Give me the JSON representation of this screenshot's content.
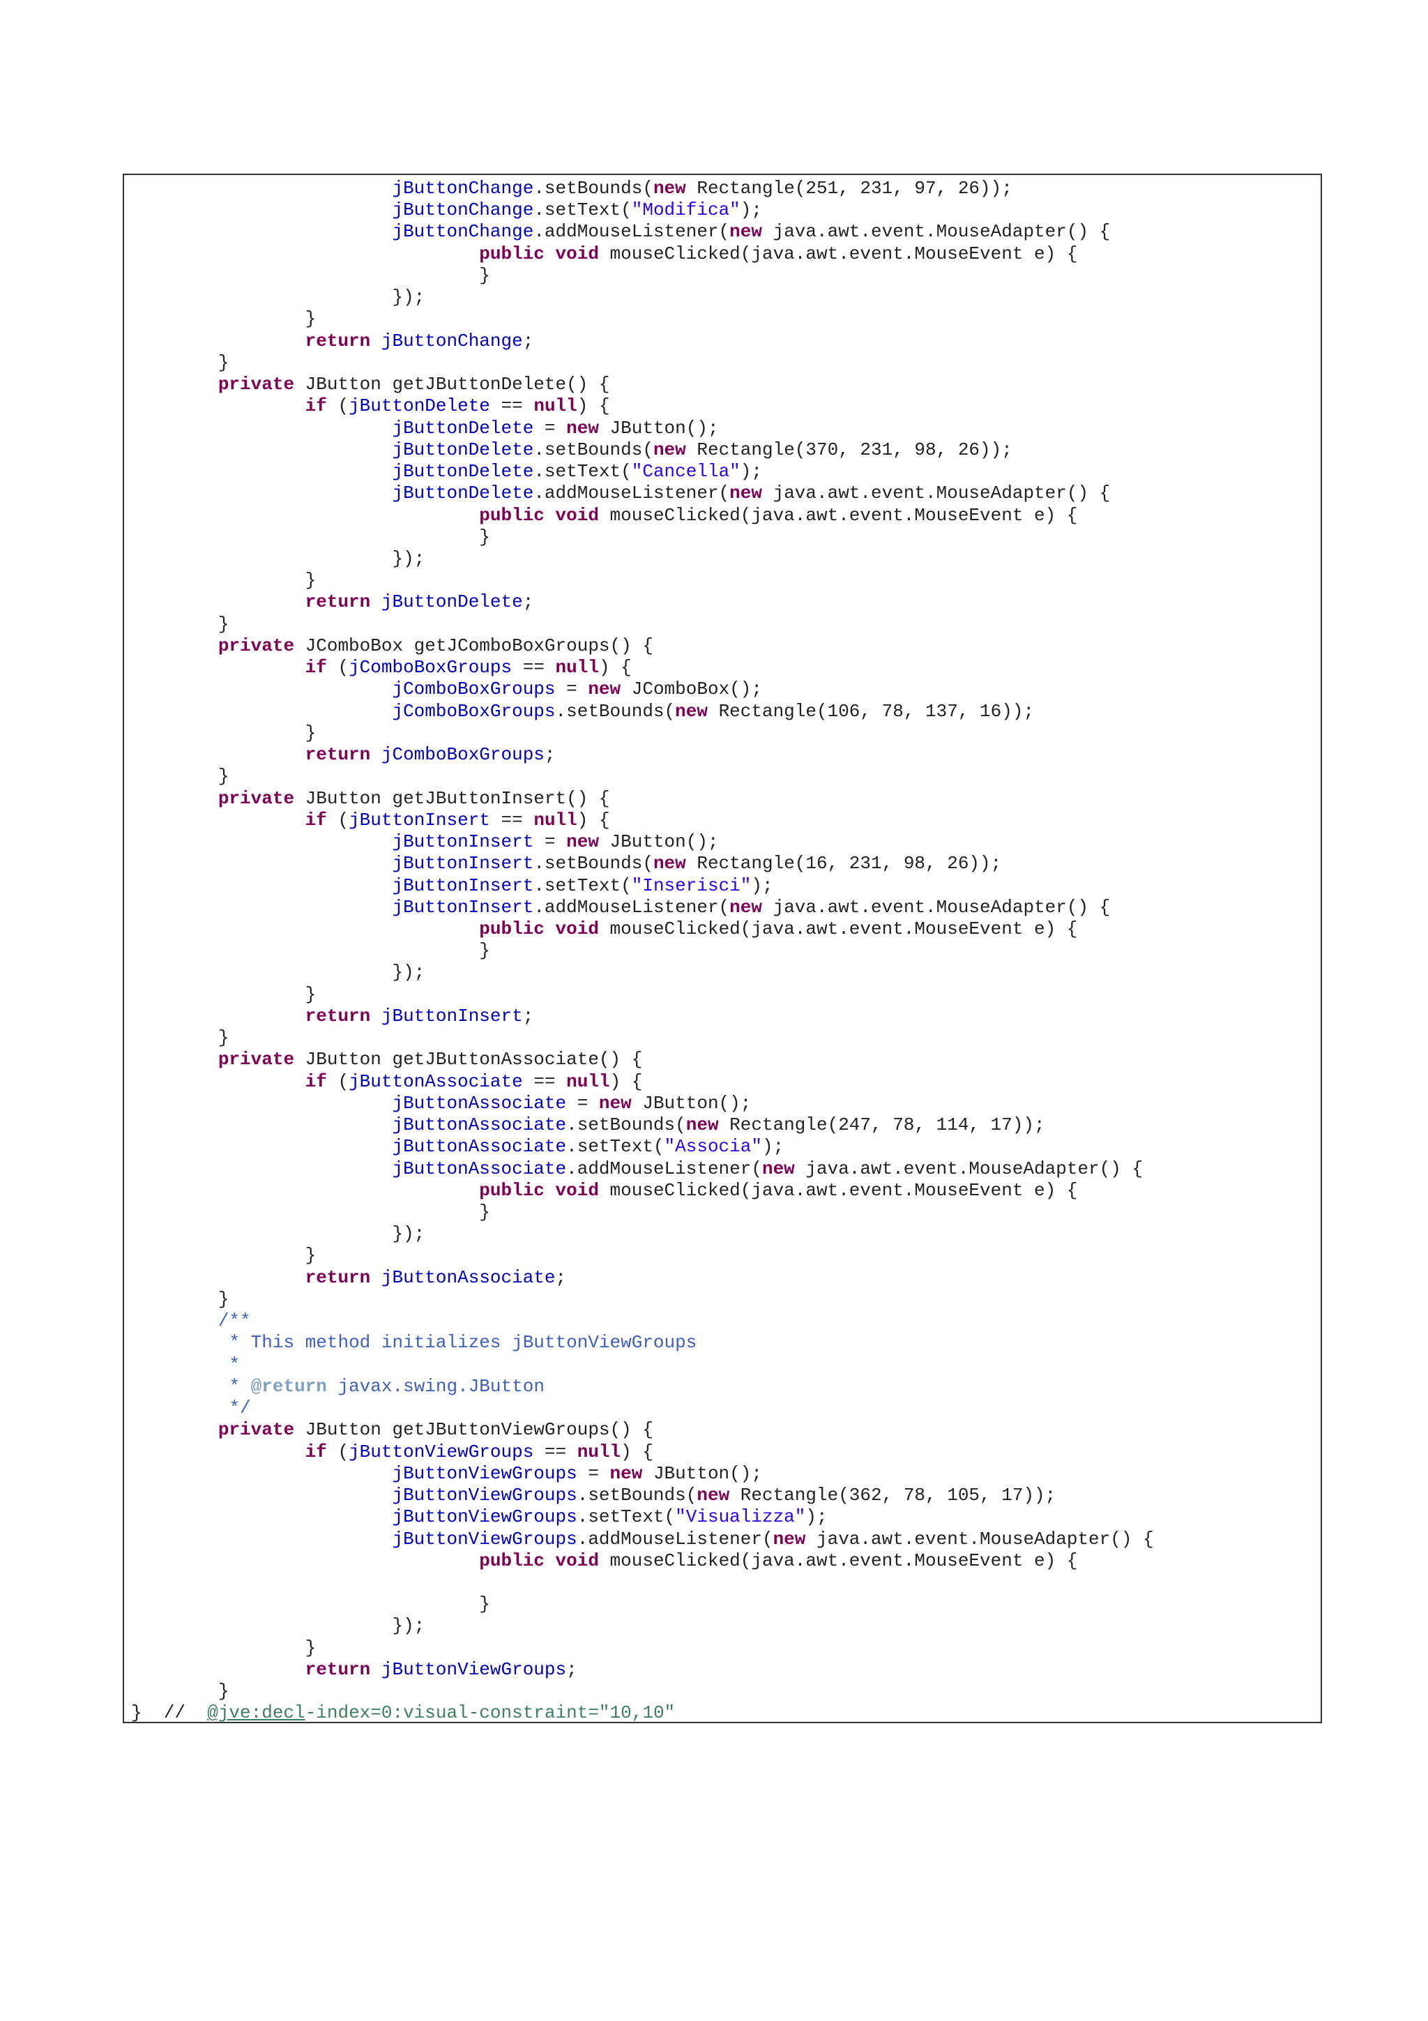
{
  "code_lines": [
    [
      {
        "c": "t",
        "s": "                        "
      },
      {
        "c": "fld",
        "s": "jButtonChange"
      },
      {
        "c": "t",
        "s": ".setBounds("
      },
      {
        "c": "kw",
        "s": "new"
      },
      {
        "c": "t",
        "s": " Rectangle(251, 231, 97, 26));"
      }
    ],
    [
      {
        "c": "t",
        "s": "                        "
      },
      {
        "c": "fld",
        "s": "jButtonChange"
      },
      {
        "c": "t",
        "s": ".setText("
      },
      {
        "c": "str",
        "s": "\"Modifica\""
      },
      {
        "c": "t",
        "s": ");"
      }
    ],
    [
      {
        "c": "t",
        "s": "                        "
      },
      {
        "c": "fld",
        "s": "jButtonChange"
      },
      {
        "c": "t",
        "s": ".addMouseListener("
      },
      {
        "c": "kw",
        "s": "new"
      },
      {
        "c": "t",
        "s": " java.awt.event.MouseAdapter() {"
      }
    ],
    [
      {
        "c": "t",
        "s": "                                "
      },
      {
        "c": "kw",
        "s": "public"
      },
      {
        "c": "t",
        "s": " "
      },
      {
        "c": "kw",
        "s": "void"
      },
      {
        "c": "t",
        "s": " mouseClicked(java.awt.event.MouseEvent e) {"
      }
    ],
    [
      {
        "c": "t",
        "s": "                                }"
      }
    ],
    [
      {
        "c": "t",
        "s": "                        });"
      }
    ],
    [
      {
        "c": "t",
        "s": "                }"
      }
    ],
    [
      {
        "c": "t",
        "s": "                "
      },
      {
        "c": "kw",
        "s": "return"
      },
      {
        "c": "t",
        "s": " "
      },
      {
        "c": "fld",
        "s": "jButtonChange"
      },
      {
        "c": "t",
        "s": ";"
      }
    ],
    [
      {
        "c": "t",
        "s": "        }"
      }
    ],
    [
      {
        "c": "t",
        "s": "        "
      },
      {
        "c": "kw",
        "s": "private"
      },
      {
        "c": "t",
        "s": " JButton getJButtonDelete() {"
      }
    ],
    [
      {
        "c": "t",
        "s": "                "
      },
      {
        "c": "kw",
        "s": "if"
      },
      {
        "c": "t",
        "s": " ("
      },
      {
        "c": "fld",
        "s": "jButtonDelete"
      },
      {
        "c": "t",
        "s": " == "
      },
      {
        "c": "kw",
        "s": "null"
      },
      {
        "c": "t",
        "s": ") {"
      }
    ],
    [
      {
        "c": "t",
        "s": "                        "
      },
      {
        "c": "fld",
        "s": "jButtonDelete"
      },
      {
        "c": "t",
        "s": " = "
      },
      {
        "c": "kw",
        "s": "new"
      },
      {
        "c": "t",
        "s": " JButton();"
      }
    ],
    [
      {
        "c": "t",
        "s": "                        "
      },
      {
        "c": "fld",
        "s": "jButtonDelete"
      },
      {
        "c": "t",
        "s": ".setBounds("
      },
      {
        "c": "kw",
        "s": "new"
      },
      {
        "c": "t",
        "s": " Rectangle(370, 231, 98, 26));"
      }
    ],
    [
      {
        "c": "t",
        "s": "                        "
      },
      {
        "c": "fld",
        "s": "jButtonDelete"
      },
      {
        "c": "t",
        "s": ".setText("
      },
      {
        "c": "str",
        "s": "\"Cancella\""
      },
      {
        "c": "t",
        "s": ");"
      }
    ],
    [
      {
        "c": "t",
        "s": "                        "
      },
      {
        "c": "fld",
        "s": "jButtonDelete"
      },
      {
        "c": "t",
        "s": ".addMouseListener("
      },
      {
        "c": "kw",
        "s": "new"
      },
      {
        "c": "t",
        "s": " java.awt.event.MouseAdapter() {"
      }
    ],
    [
      {
        "c": "t",
        "s": "                                "
      },
      {
        "c": "kw",
        "s": "public"
      },
      {
        "c": "t",
        "s": " "
      },
      {
        "c": "kw",
        "s": "void"
      },
      {
        "c": "t",
        "s": " mouseClicked(java.awt.event.MouseEvent e) {"
      }
    ],
    [
      {
        "c": "t",
        "s": "                                }"
      }
    ],
    [
      {
        "c": "t",
        "s": "                        });"
      }
    ],
    [
      {
        "c": "t",
        "s": "                }"
      }
    ],
    [
      {
        "c": "t",
        "s": "                "
      },
      {
        "c": "kw",
        "s": "return"
      },
      {
        "c": "t",
        "s": " "
      },
      {
        "c": "fld",
        "s": "jButtonDelete"
      },
      {
        "c": "t",
        "s": ";"
      }
    ],
    [
      {
        "c": "t",
        "s": "        }"
      }
    ],
    [
      {
        "c": "t",
        "s": "        "
      },
      {
        "c": "kw",
        "s": "private"
      },
      {
        "c": "t",
        "s": " JComboBox getJComboBoxGroups() {"
      }
    ],
    [
      {
        "c": "t",
        "s": "                "
      },
      {
        "c": "kw",
        "s": "if"
      },
      {
        "c": "t",
        "s": " ("
      },
      {
        "c": "fld",
        "s": "jComboBoxGroups"
      },
      {
        "c": "t",
        "s": " == "
      },
      {
        "c": "kw",
        "s": "null"
      },
      {
        "c": "t",
        "s": ") {"
      }
    ],
    [
      {
        "c": "t",
        "s": "                        "
      },
      {
        "c": "fld",
        "s": "jComboBoxGroups"
      },
      {
        "c": "t",
        "s": " = "
      },
      {
        "c": "kw",
        "s": "new"
      },
      {
        "c": "t",
        "s": " JComboBox();"
      }
    ],
    [
      {
        "c": "t",
        "s": "                        "
      },
      {
        "c": "fld",
        "s": "jComboBoxGroups"
      },
      {
        "c": "t",
        "s": ".setBounds("
      },
      {
        "c": "kw",
        "s": "new"
      },
      {
        "c": "t",
        "s": " Rectangle(106, 78, 137, 16));"
      }
    ],
    [
      {
        "c": "t",
        "s": "                }"
      }
    ],
    [
      {
        "c": "t",
        "s": "                "
      },
      {
        "c": "kw",
        "s": "return"
      },
      {
        "c": "t",
        "s": " "
      },
      {
        "c": "fld",
        "s": "jComboBoxGroups"
      },
      {
        "c": "t",
        "s": ";"
      }
    ],
    [
      {
        "c": "t",
        "s": "        }"
      }
    ],
    [
      {
        "c": "t",
        "s": "        "
      },
      {
        "c": "kw",
        "s": "private"
      },
      {
        "c": "t",
        "s": " JButton getJButtonInsert() {"
      }
    ],
    [
      {
        "c": "t",
        "s": "                "
      },
      {
        "c": "kw",
        "s": "if"
      },
      {
        "c": "t",
        "s": " ("
      },
      {
        "c": "fld",
        "s": "jButtonInsert"
      },
      {
        "c": "t",
        "s": " == "
      },
      {
        "c": "kw",
        "s": "null"
      },
      {
        "c": "t",
        "s": ") {"
      }
    ],
    [
      {
        "c": "t",
        "s": "                        "
      },
      {
        "c": "fld",
        "s": "jButtonInsert"
      },
      {
        "c": "t",
        "s": " = "
      },
      {
        "c": "kw",
        "s": "new"
      },
      {
        "c": "t",
        "s": " JButton();"
      }
    ],
    [
      {
        "c": "t",
        "s": "                        "
      },
      {
        "c": "fld",
        "s": "jButtonInsert"
      },
      {
        "c": "t",
        "s": ".setBounds("
      },
      {
        "c": "kw",
        "s": "new"
      },
      {
        "c": "t",
        "s": " Rectangle(16, 231, 98, 26));"
      }
    ],
    [
      {
        "c": "t",
        "s": "                        "
      },
      {
        "c": "fld",
        "s": "jButtonInsert"
      },
      {
        "c": "t",
        "s": ".setText("
      },
      {
        "c": "str",
        "s": "\"Inserisci\""
      },
      {
        "c": "t",
        "s": ");"
      }
    ],
    [
      {
        "c": "t",
        "s": "                        "
      },
      {
        "c": "fld",
        "s": "jButtonInsert"
      },
      {
        "c": "t",
        "s": ".addMouseListener("
      },
      {
        "c": "kw",
        "s": "new"
      },
      {
        "c": "t",
        "s": " java.awt.event.MouseAdapter() {"
      }
    ],
    [
      {
        "c": "t",
        "s": "                                "
      },
      {
        "c": "kw",
        "s": "public"
      },
      {
        "c": "t",
        "s": " "
      },
      {
        "c": "kw",
        "s": "void"
      },
      {
        "c": "t",
        "s": " mouseClicked(java.awt.event.MouseEvent e) {"
      }
    ],
    [
      {
        "c": "t",
        "s": "                                }"
      }
    ],
    [
      {
        "c": "t",
        "s": "                        });"
      }
    ],
    [
      {
        "c": "t",
        "s": "                }"
      }
    ],
    [
      {
        "c": "t",
        "s": "                "
      },
      {
        "c": "kw",
        "s": "return"
      },
      {
        "c": "t",
        "s": " "
      },
      {
        "c": "fld",
        "s": "jButtonInsert"
      },
      {
        "c": "t",
        "s": ";"
      }
    ],
    [
      {
        "c": "t",
        "s": "        }"
      }
    ],
    [
      {
        "c": "t",
        "s": "        "
      },
      {
        "c": "kw",
        "s": "private"
      },
      {
        "c": "t",
        "s": " JButton getJButtonAssociate() {"
      }
    ],
    [
      {
        "c": "t",
        "s": "                "
      },
      {
        "c": "kw",
        "s": "if"
      },
      {
        "c": "t",
        "s": " ("
      },
      {
        "c": "fld",
        "s": "jButtonAssociate"
      },
      {
        "c": "t",
        "s": " == "
      },
      {
        "c": "kw",
        "s": "null"
      },
      {
        "c": "t",
        "s": ") {"
      }
    ],
    [
      {
        "c": "t",
        "s": "                        "
      },
      {
        "c": "fld",
        "s": "jButtonAssociate"
      },
      {
        "c": "t",
        "s": " = "
      },
      {
        "c": "kw",
        "s": "new"
      },
      {
        "c": "t",
        "s": " JButton();"
      }
    ],
    [
      {
        "c": "t",
        "s": "                        "
      },
      {
        "c": "fld",
        "s": "jButtonAssociate"
      },
      {
        "c": "t",
        "s": ".setBounds("
      },
      {
        "c": "kw",
        "s": "new"
      },
      {
        "c": "t",
        "s": " Rectangle(247, 78, 114, 17));"
      }
    ],
    [
      {
        "c": "t",
        "s": "                        "
      },
      {
        "c": "fld",
        "s": "jButtonAssociate"
      },
      {
        "c": "t",
        "s": ".setText("
      },
      {
        "c": "str",
        "s": "\"Associa\""
      },
      {
        "c": "t",
        "s": ");"
      }
    ],
    [
      {
        "c": "t",
        "s": "                        "
      },
      {
        "c": "fld",
        "s": "jButtonAssociate"
      },
      {
        "c": "t",
        "s": ".addMouseListener("
      },
      {
        "c": "kw",
        "s": "new"
      },
      {
        "c": "t",
        "s": " java.awt.event.MouseAdapter() {"
      }
    ],
    [
      {
        "c": "t",
        "s": "                                "
      },
      {
        "c": "kw",
        "s": "public"
      },
      {
        "c": "t",
        "s": " "
      },
      {
        "c": "kw",
        "s": "void"
      },
      {
        "c": "t",
        "s": " mouseClicked(java.awt.event.MouseEvent e) {"
      }
    ],
    [
      {
        "c": "t",
        "s": "                                }"
      }
    ],
    [
      {
        "c": "t",
        "s": "                        });"
      }
    ],
    [
      {
        "c": "t",
        "s": "                }"
      }
    ],
    [
      {
        "c": "t",
        "s": "                "
      },
      {
        "c": "kw",
        "s": "return"
      },
      {
        "c": "t",
        "s": " "
      },
      {
        "c": "fld",
        "s": "jButtonAssociate"
      },
      {
        "c": "t",
        "s": ";"
      }
    ],
    [
      {
        "c": "t",
        "s": "        }"
      }
    ],
    [
      {
        "c": "t",
        "s": "        "
      },
      {
        "c": "cmt",
        "s": "/**"
      }
    ],
    [
      {
        "c": "t",
        "s": "         "
      },
      {
        "c": "cmt",
        "s": "* This method initializes jButtonViewGroups"
      }
    ],
    [
      {
        "c": "t",
        "s": "         "
      },
      {
        "c": "cmt",
        "s": "*"
      }
    ],
    [
      {
        "c": "t",
        "s": "         "
      },
      {
        "c": "cmt",
        "s": "* "
      },
      {
        "c": "tag",
        "s": "@return"
      },
      {
        "c": "cmt",
        "s": " javax.swing.JButton"
      }
    ],
    [
      {
        "c": "t",
        "s": "         "
      },
      {
        "c": "cmt",
        "s": "*/"
      }
    ],
    [
      {
        "c": "t",
        "s": "        "
      },
      {
        "c": "kw",
        "s": "private"
      },
      {
        "c": "t",
        "s": " JButton getJButtonViewGroups() {"
      }
    ],
    [
      {
        "c": "t",
        "s": "                "
      },
      {
        "c": "kw",
        "s": "if"
      },
      {
        "c": "t",
        "s": " ("
      },
      {
        "c": "fld",
        "s": "jButtonViewGroups"
      },
      {
        "c": "t",
        "s": " == "
      },
      {
        "c": "kw",
        "s": "null"
      },
      {
        "c": "t",
        "s": ") {"
      }
    ],
    [
      {
        "c": "t",
        "s": "                        "
      },
      {
        "c": "fld",
        "s": "jButtonViewGroups"
      },
      {
        "c": "t",
        "s": " = "
      },
      {
        "c": "kw",
        "s": "new"
      },
      {
        "c": "t",
        "s": " JButton();"
      }
    ],
    [
      {
        "c": "t",
        "s": "                        "
      },
      {
        "c": "fld",
        "s": "jButtonViewGroups"
      },
      {
        "c": "t",
        "s": ".setBounds("
      },
      {
        "c": "kw",
        "s": "new"
      },
      {
        "c": "t",
        "s": " Rectangle(362, 78, 105, 17));"
      }
    ],
    [
      {
        "c": "t",
        "s": "                        "
      },
      {
        "c": "fld",
        "s": "jButtonViewGroups"
      },
      {
        "c": "t",
        "s": ".setText("
      },
      {
        "c": "str",
        "s": "\"Visualizza\""
      },
      {
        "c": "t",
        "s": ");"
      }
    ],
    [
      {
        "c": "t",
        "s": "                        "
      },
      {
        "c": "fld",
        "s": "jButtonViewGroups"
      },
      {
        "c": "t",
        "s": ".addMouseListener("
      },
      {
        "c": "kw",
        "s": "new"
      },
      {
        "c": "t",
        "s": " java.awt.event.MouseAdapter() {"
      }
    ],
    [
      {
        "c": "t",
        "s": "                                "
      },
      {
        "c": "kw",
        "s": "public"
      },
      {
        "c": "t",
        "s": " "
      },
      {
        "c": "kw",
        "s": "void"
      },
      {
        "c": "t",
        "s": " mouseClicked(java.awt.event.MouseEvent e) {"
      }
    ],
    [
      {
        "c": "t",
        "s": ""
      }
    ],
    [
      {
        "c": "t",
        "s": "                                }"
      }
    ],
    [
      {
        "c": "t",
        "s": "                        });"
      }
    ],
    [
      {
        "c": "t",
        "s": "                }"
      }
    ],
    [
      {
        "c": "t",
        "s": "                "
      },
      {
        "c": "kw",
        "s": "return"
      },
      {
        "c": "t",
        "s": " "
      },
      {
        "c": "fld",
        "s": "jButtonViewGroups"
      },
      {
        "c": "t",
        "s": ";"
      }
    ],
    [
      {
        "c": "t",
        "s": "        }"
      }
    ],
    [
      {
        "c": "t",
        "s": "}  //  "
      },
      {
        "c": "jve-link",
        "s": "@jve:decl"
      },
      {
        "c": "jve",
        "s": "-index=0:visual-constraint=\"10,10\""
      }
    ]
  ],
  "colors": {
    "keyword": "#7f0055",
    "field": "#0000c0",
    "string": "#2a00ff",
    "comment": "#3f5fbf",
    "javadoc_tag": "#7f9fbf",
    "annotation": "#3f7f5f",
    "text": "#222222",
    "frame_border": "#333333"
  }
}
